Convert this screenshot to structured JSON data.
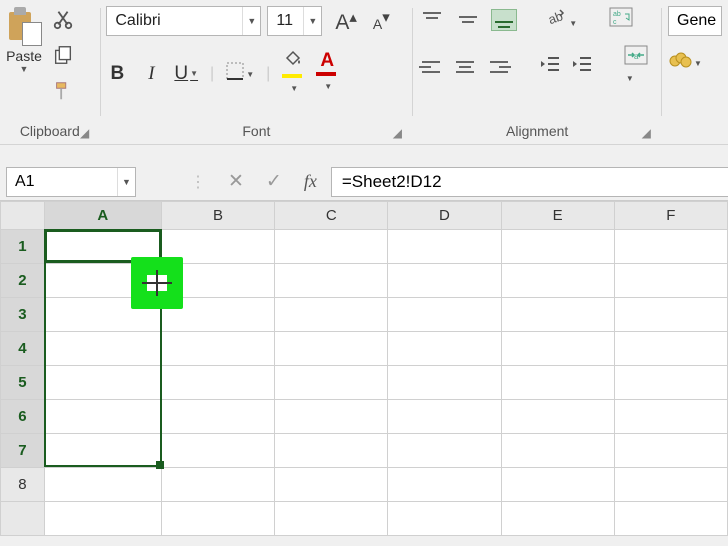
{
  "ribbon": {
    "clipboard": {
      "label": "Clipboard",
      "paste": "Paste"
    },
    "font": {
      "label": "Font",
      "name": "Calibri",
      "size": "11",
      "bold": "B",
      "italic": "I",
      "underline": "U",
      "bigger_glyph": "A",
      "smaller_glyph": "A",
      "color_glyph": "A"
    },
    "alignment": {
      "label": "Alignment"
    },
    "number": {
      "label_visible": "Gene"
    }
  },
  "formula_bar": {
    "name_box": "A1",
    "fx": "fx",
    "formula": "=Sheet2!D12"
  },
  "grid": {
    "columns": [
      "A",
      "B",
      "C",
      "D",
      "E",
      "F"
    ],
    "rows": [
      "1",
      "2",
      "3",
      "4",
      "5",
      "6",
      "7",
      "8"
    ],
    "active_cell": "A1",
    "selection": "A1:A7"
  }
}
